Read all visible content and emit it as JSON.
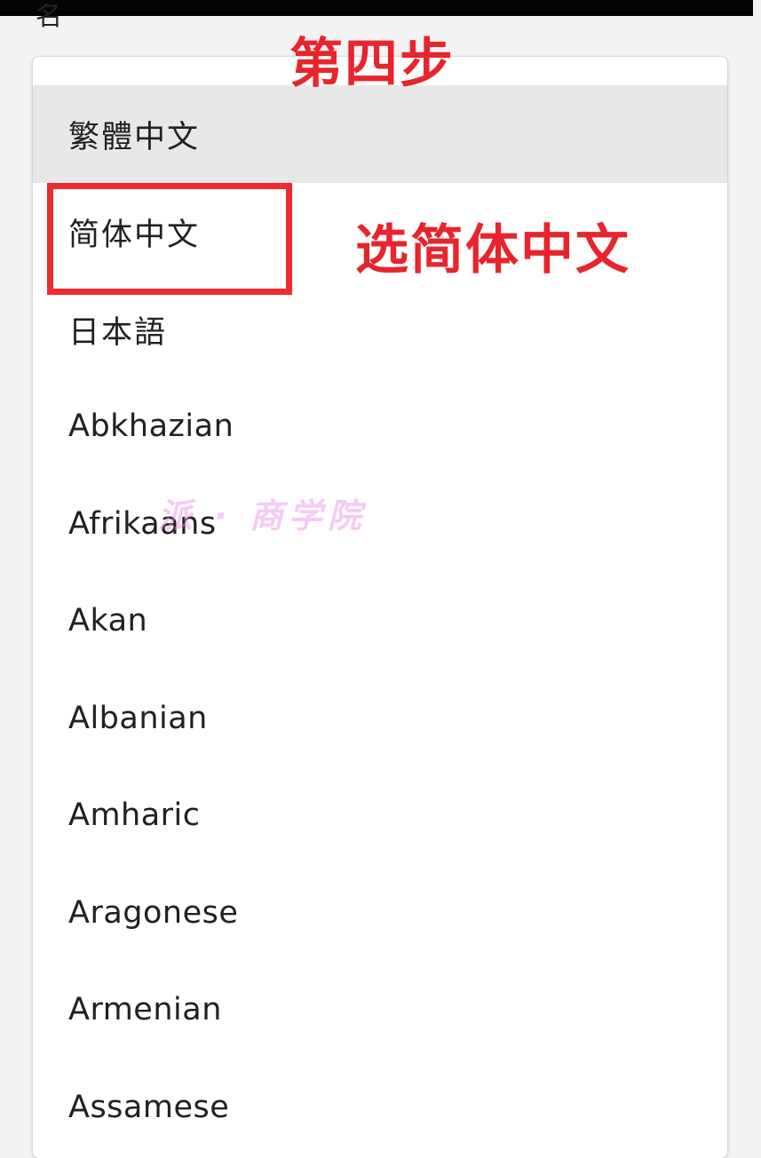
{
  "background": {
    "partial_glyph": "名"
  },
  "dropdown": {
    "items": [
      {
        "label": "繁體中文"
      },
      {
        "label": "简体中文"
      },
      {
        "label": "日本語"
      },
      {
        "label": "Abkhazian"
      },
      {
        "label": "Afrikaans"
      },
      {
        "label": "Akan"
      },
      {
        "label": "Albanian"
      },
      {
        "label": "Amharic"
      },
      {
        "label": "Aragonese"
      },
      {
        "label": "Armenian"
      },
      {
        "label": "Assamese"
      }
    ],
    "selected_label": "繁體中文"
  },
  "annotations": {
    "step": "第四步",
    "instruction": "选简体中文",
    "highlight_color": "#ef2b30",
    "text_color": "#e8242c"
  },
  "watermark": {
    "text": "派 · 商学院"
  }
}
